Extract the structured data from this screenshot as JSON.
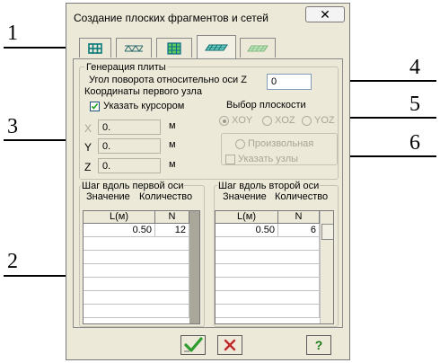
{
  "callouts": [
    "1",
    "2",
    "3",
    "4",
    "5",
    "6"
  ],
  "dialog": {
    "title": "Создание плоских фрагментов и сетей",
    "close_label": "✕"
  },
  "tabs": [
    {
      "icon": "frame-grid-icon",
      "active": false
    },
    {
      "icon": "truss-icon",
      "active": false
    },
    {
      "icon": "green-grid-icon",
      "active": false
    },
    {
      "icon": "plate-icon",
      "active": true
    },
    {
      "icon": "mesh-icon",
      "active": false
    }
  ],
  "plate": {
    "group_title": "Генерация плиты",
    "rotation_label": "Угол поворота относительно оси Z",
    "rotation_value": "0",
    "first_node_label": "Координаты первого узла",
    "cursor_label": "Указать курсором",
    "cursor_checked": true,
    "coords": [
      {
        "axis": "X",
        "value": "0.",
        "unit": "м"
      },
      {
        "axis": "Y",
        "value": "0.",
        "unit": "м"
      },
      {
        "axis": "Z",
        "value": "0.",
        "unit": "м"
      }
    ]
  },
  "plane": {
    "title": "Выбор плоскости",
    "options": [
      "XOY",
      "XOZ",
      "YOZ"
    ],
    "selected": "XOY",
    "arbitrary_label": "Произвольная",
    "nodes_label": "Указать узлы"
  },
  "step1": {
    "title": "Шаг вдоль первой оси",
    "col_value": "Значение",
    "col_count": "Количество",
    "header_l": "L(м)",
    "header_n": "N",
    "rows": [
      {
        "l": "0.50",
        "n": "12"
      }
    ]
  },
  "step2": {
    "title": "Шаг вдоль второй оси",
    "col_value": "Значение",
    "col_count": "Количество",
    "header_l": "L(м)",
    "header_n": "N",
    "rows": [
      {
        "l": "0.50",
        "n": "6"
      }
    ]
  },
  "buttons": {
    "ok_icon": "apply-check-icon",
    "cancel_icon": "cancel-x-icon",
    "help_label": "?"
  },
  "colors": {
    "dialog_bg": "#ece9d8",
    "ok_green": "#2e9d2e",
    "cancel_red": "#c0282d",
    "help_green": "#1a7a1a",
    "tab_icon_teal": "#0a8a8a"
  }
}
